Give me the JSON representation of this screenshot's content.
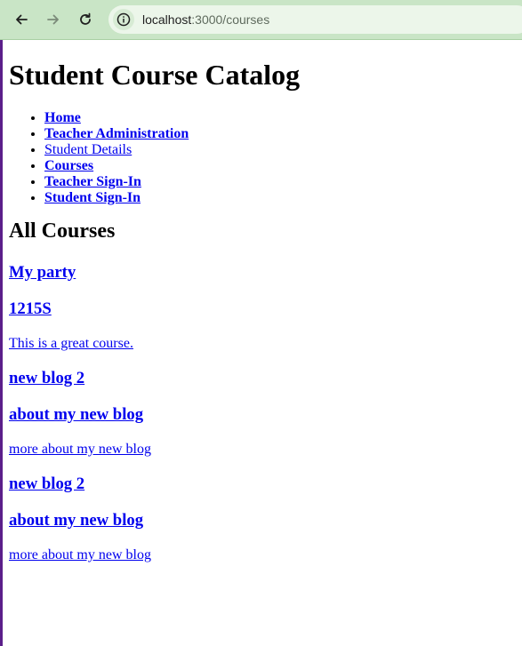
{
  "browser": {
    "url_host": "localhost",
    "url_path": ":3000/courses"
  },
  "page": {
    "title": "Student Course Catalog",
    "nav": [
      {
        "label": "Home",
        "bold": true
      },
      {
        "label": "Teacher Administration",
        "bold": true
      },
      {
        "label": "Student Details",
        "bold": false
      },
      {
        "label": "Courses",
        "bold": true
      },
      {
        "label": "Teacher Sign-In",
        "bold": true
      },
      {
        "label": "Student Sign-In",
        "bold": true
      }
    ],
    "section_heading": "All Courses",
    "courses": [
      {
        "title": "My party",
        "description": ""
      },
      {
        "title": "1215S",
        "description": "This is a great course."
      },
      {
        "title": "new blog 2",
        "description": ""
      },
      {
        "title": "about my new blog",
        "description": "more about my new blog"
      },
      {
        "title": "new blog 2",
        "description": ""
      },
      {
        "title": "about my new blog",
        "description": "more about my new blog"
      }
    ]
  },
  "colors": {
    "toolbar": "#c9e5c6",
    "link": "#0000ee",
    "edge": "#5b1f8a"
  },
  "icons": {
    "back": "arrow-left-icon",
    "forward": "arrow-right-icon",
    "reload": "reload-icon",
    "site_info": "info-icon"
  }
}
